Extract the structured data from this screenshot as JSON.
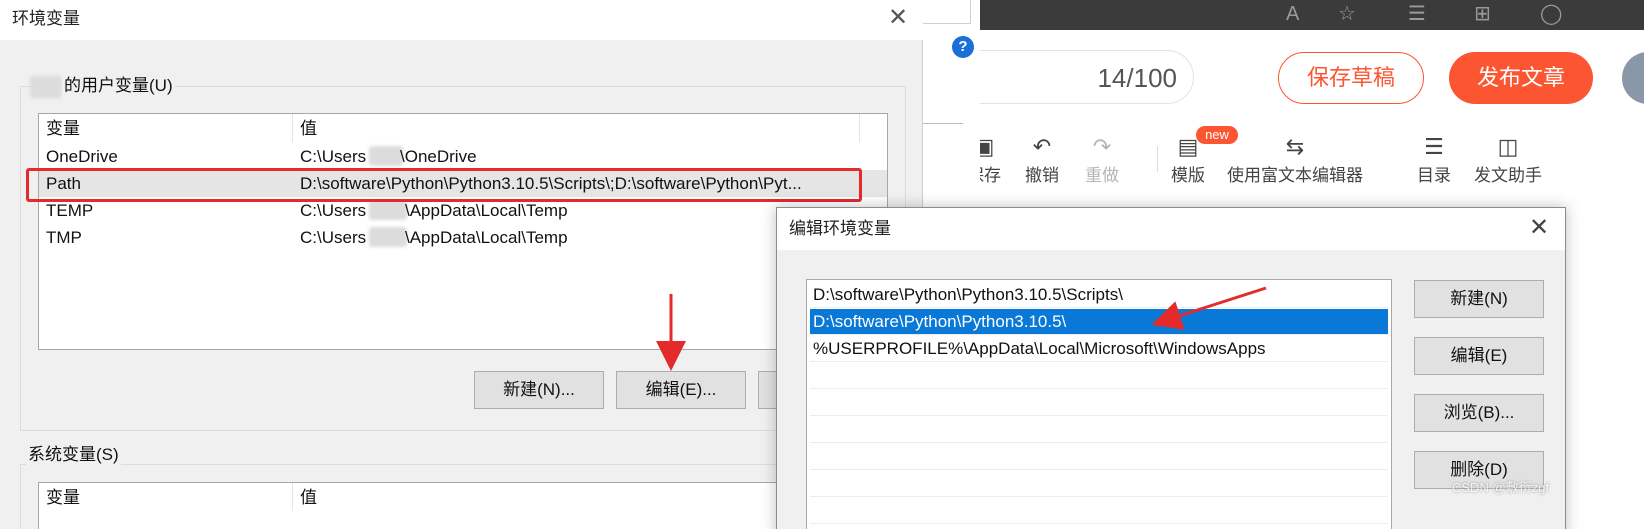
{
  "env_dialog": {
    "title": "环境变量",
    "user_group_label": "的用户变量(U)",
    "system_group_label": "系统变量(S)",
    "columns": [
      "变量",
      "值"
    ],
    "user_vars": [
      {
        "name": "OneDrive",
        "value_prefix": "C:\\Users",
        "value_suffix": "\\OneDrive"
      },
      {
        "name": "Path",
        "value": "D:\\software\\Python\\Python3.10.5\\Scripts\\;D:\\software\\Python\\Pyt..."
      },
      {
        "name": "TEMP",
        "value_prefix": "C:\\Users",
        "value_suffix": "\\AppData\\Local\\Temp"
      },
      {
        "name": "TMP",
        "value_prefix": "C:\\Users",
        "value_suffix": "\\AppData\\Local\\Temp"
      }
    ],
    "buttons": {
      "new": "新建(N)...",
      "edit": "编辑(E)..."
    }
  },
  "edit_dialog": {
    "title": "编辑环境变量",
    "entries": [
      "D:\\software\\Python\\Python3.10.5\\Scripts\\",
      "D:\\software\\Python\\Python3.10.5\\",
      "%USERPROFILE%\\AppData\\Local\\Microsoft\\WindowsApps"
    ],
    "selected_index": 1,
    "buttons": {
      "new": "新建(N)",
      "edit": "编辑(E)",
      "browse": "浏览(B)...",
      "delete": "删除(D)"
    }
  },
  "editor": {
    "counter": "14/100",
    "save_draft": "保存草稿",
    "publish": "发布文章",
    "toolbar": [
      {
        "label": "保存",
        "icon": "save-icon"
      },
      {
        "label": "撤销",
        "icon": "undo-icon"
      },
      {
        "label": "重做",
        "icon": "redo-icon"
      },
      {
        "label": "模版",
        "icon": "template-icon"
      },
      {
        "label": "使用富文本编辑器",
        "icon": "switch-icon"
      },
      {
        "label": "目录",
        "icon": "toc-icon"
      },
      {
        "label": "发文助手",
        "icon": "assistant-icon"
      }
    ],
    "new_badge": "new"
  },
  "watermark": "CSDN @敷衍zgf",
  "colors": {
    "accent": "#fc5531",
    "selection": "#0a78d7",
    "highlight_box": "#e32b2b"
  }
}
